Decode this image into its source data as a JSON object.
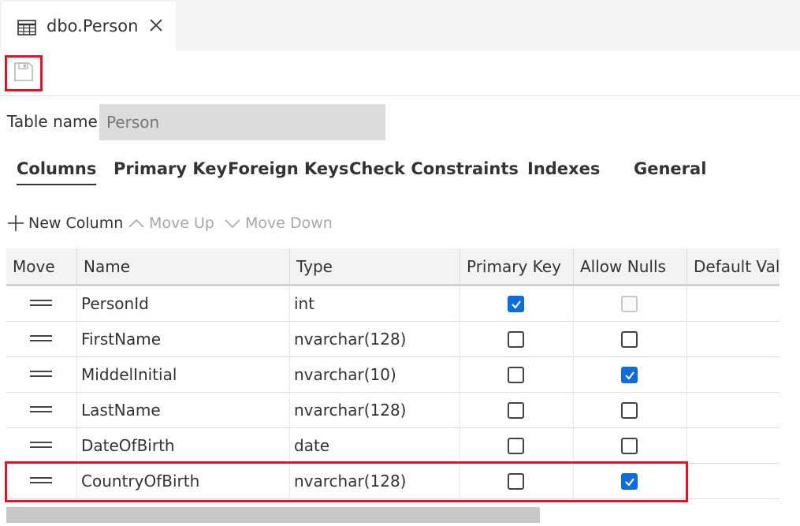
{
  "tab": {
    "title": "dbo.Person"
  },
  "table_name": {
    "label": "Table name",
    "value": "Person"
  },
  "subtabs": [
    "Columns",
    "Primary Key",
    "Foreign Keys",
    "Check Constraints",
    "Indexes",
    "General"
  ],
  "actions": {
    "new_column": "New Column",
    "move_up": "Move Up",
    "move_down": "Move Down"
  },
  "grid": {
    "headers": [
      "Move",
      "Name",
      "Type",
      "Primary Key",
      "Allow Nulls",
      "Default Value"
    ],
    "rows": [
      {
        "name": "PersonId",
        "type": "int",
        "primary_key": true,
        "allow_nulls": false,
        "allow_nulls_disabled": true
      },
      {
        "name": "FirstName",
        "type": "nvarchar(128)",
        "primary_key": false,
        "allow_nulls": false
      },
      {
        "name": "MiddelInitial",
        "type": "nvarchar(10)",
        "primary_key": false,
        "allow_nulls": true
      },
      {
        "name": "LastName",
        "type": "nvarchar(128)",
        "primary_key": false,
        "allow_nulls": false
      },
      {
        "name": "DateOfBirth",
        "type": "date",
        "primary_key": false,
        "allow_nulls": false
      },
      {
        "name": "CountryOfBirth",
        "type": "nvarchar(128)",
        "primary_key": false,
        "allow_nulls": true
      }
    ]
  },
  "colors": {
    "accent": "#0f6cde",
    "highlight": "#e81123"
  }
}
